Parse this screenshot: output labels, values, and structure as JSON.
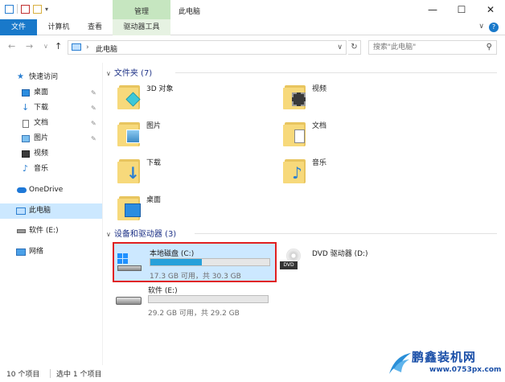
{
  "titlebar": {
    "context_tab_label": "管理",
    "window_title": "此电脑",
    "minimize": "—",
    "maximize": "☐",
    "close": "✕"
  },
  "ribbon": {
    "tabs": [
      "文件",
      "计算机",
      "查看",
      "驱动器工具"
    ],
    "help": "?",
    "collapse": "∨"
  },
  "address": {
    "back": "←",
    "forward": "→",
    "recent": "∨",
    "up": "↑",
    "crumb_sep": "›",
    "crumb": "此电脑",
    "dropdown": "∨",
    "refresh": "↻",
    "search_placeholder": "搜索\"此电脑\"",
    "search_icon": "⚲"
  },
  "sidebar": {
    "items": [
      {
        "label": "快速访问",
        "icon": "star-icon",
        "pinned": false
      },
      {
        "label": "桌面",
        "icon": "desktop-icon",
        "pinned": true
      },
      {
        "label": "下载",
        "icon": "download-icon",
        "pinned": true
      },
      {
        "label": "文档",
        "icon": "document-icon",
        "pinned": true
      },
      {
        "label": "图片",
        "icon": "picture-icon",
        "pinned": true
      },
      {
        "label": "视频",
        "icon": "video-icon",
        "pinned": false
      },
      {
        "label": "音乐",
        "icon": "music-icon",
        "pinned": false
      },
      {
        "label": "OneDrive",
        "icon": "cloud-icon",
        "pinned": false
      },
      {
        "label": "此电脑",
        "icon": "computer-icon",
        "pinned": false,
        "selected": true
      },
      {
        "label": "软件 (E:)",
        "icon": "drive-icon",
        "pinned": false
      },
      {
        "label": "网络",
        "icon": "network-icon",
        "pinned": false
      }
    ],
    "pin_glyph": "📌"
  },
  "main": {
    "folders_header": "文件夹 (7)",
    "folders": [
      {
        "name": "3D 对象",
        "icon": "3d-objects-icon"
      },
      {
        "name": "视频",
        "icon": "video-icon"
      },
      {
        "name": "图片",
        "icon": "picture-icon"
      },
      {
        "name": "文档",
        "icon": "document-icon"
      },
      {
        "name": "下载",
        "icon": "download-icon"
      },
      {
        "name": "音乐",
        "icon": "music-icon"
      },
      {
        "name": "桌面",
        "icon": "desktop-icon"
      }
    ],
    "drives_header": "设备和驱动器 (3)",
    "drives": [
      {
        "name": "本地磁盘 (C:)",
        "sub": "17.3 GB 可用，共 30.3 GB",
        "used_fraction": 0.43,
        "selected": true
      },
      {
        "name": "DVD 驱动器 (D:)",
        "dvd": true
      },
      {
        "name": "软件 (E:)",
        "sub": "29.2 GB 可用，共 29.2 GB",
        "used_fraction": 0.0
      }
    ]
  },
  "status": {
    "count": "10 个项目",
    "selection": "选中 1 个项目"
  },
  "watermark": {
    "brand": "鹏鑫装机网",
    "url": "www.0753px.com"
  },
  "colors": {
    "accent": "#1979ca",
    "selection": "#cce8ff",
    "highlight_border": "#e02020",
    "bar_fill": "#26a0da"
  }
}
